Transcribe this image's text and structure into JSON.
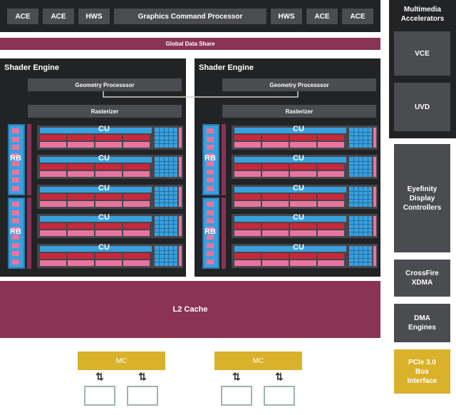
{
  "top_bar": {
    "items": [
      "ACE",
      "ACE",
      "HWS",
      "Graphics Command Processor",
      "HWS",
      "ACE",
      "ACE"
    ]
  },
  "global_data_share": "Global Data Share",
  "shader_engines": [
    {
      "title": "Shader Engine",
      "geometry": "Geometry Processsor",
      "rasterizer": "Rasterizer",
      "rb_labels": [
        "RB",
        "RB"
      ],
      "cu_labels": [
        "CU",
        "CU",
        "CU",
        "CU",
        "CU"
      ]
    },
    {
      "title": "Shader Engine",
      "geometry": "Geometry Processsor",
      "rasterizer": "Rasterizer",
      "rb_labels": [
        "RB",
        "RB"
      ],
      "cu_labels": [
        "CU",
        "CU",
        "CU",
        "CU",
        "CU"
      ]
    }
  ],
  "l2_cache": "L2 Cache",
  "memory_controllers": [
    "MC",
    "MC"
  ],
  "side_panel": {
    "multimedia_title": "Multimedia\nAccelerators",
    "vce": "VCE",
    "uvd": "UVD",
    "eyefinity": "Eyefinity\nDisplay\nControllers",
    "crossfire": "CrossFire\nXDMA",
    "dma": "DMA\nEngines",
    "pcie": "PCIe 3.0\nBus\nInterface"
  },
  "colors": {
    "dark": "#222325",
    "cu_blue": "#3aa0dd",
    "cu_red": "#c8283c",
    "cu_pink": "#e8749f",
    "maroon": "#8a3355",
    "gold": "#d9b12a"
  }
}
